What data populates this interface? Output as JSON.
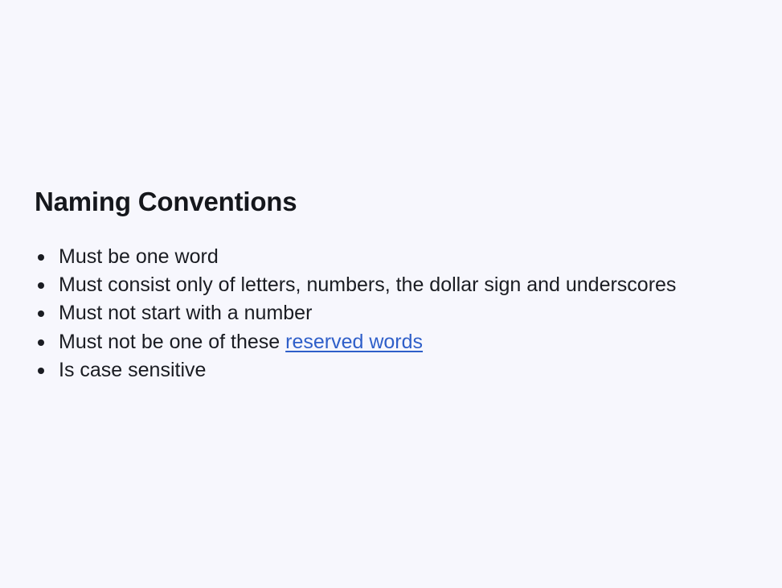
{
  "section": {
    "title": "Naming Conventions",
    "rules": [
      {
        "text": "Must be one word"
      },
      {
        "text": "Must consist only of letters, numbers, the dollar sign and underscores"
      },
      {
        "text": "Must not start with a number"
      },
      {
        "text": "Must not be one of these ",
        "link_text": "reserved words"
      },
      {
        "text": "Is case sensitive"
      }
    ]
  },
  "colors": {
    "background": "#f7f7fd",
    "text": "#1a1c22",
    "link": "#2f5fc9"
  }
}
